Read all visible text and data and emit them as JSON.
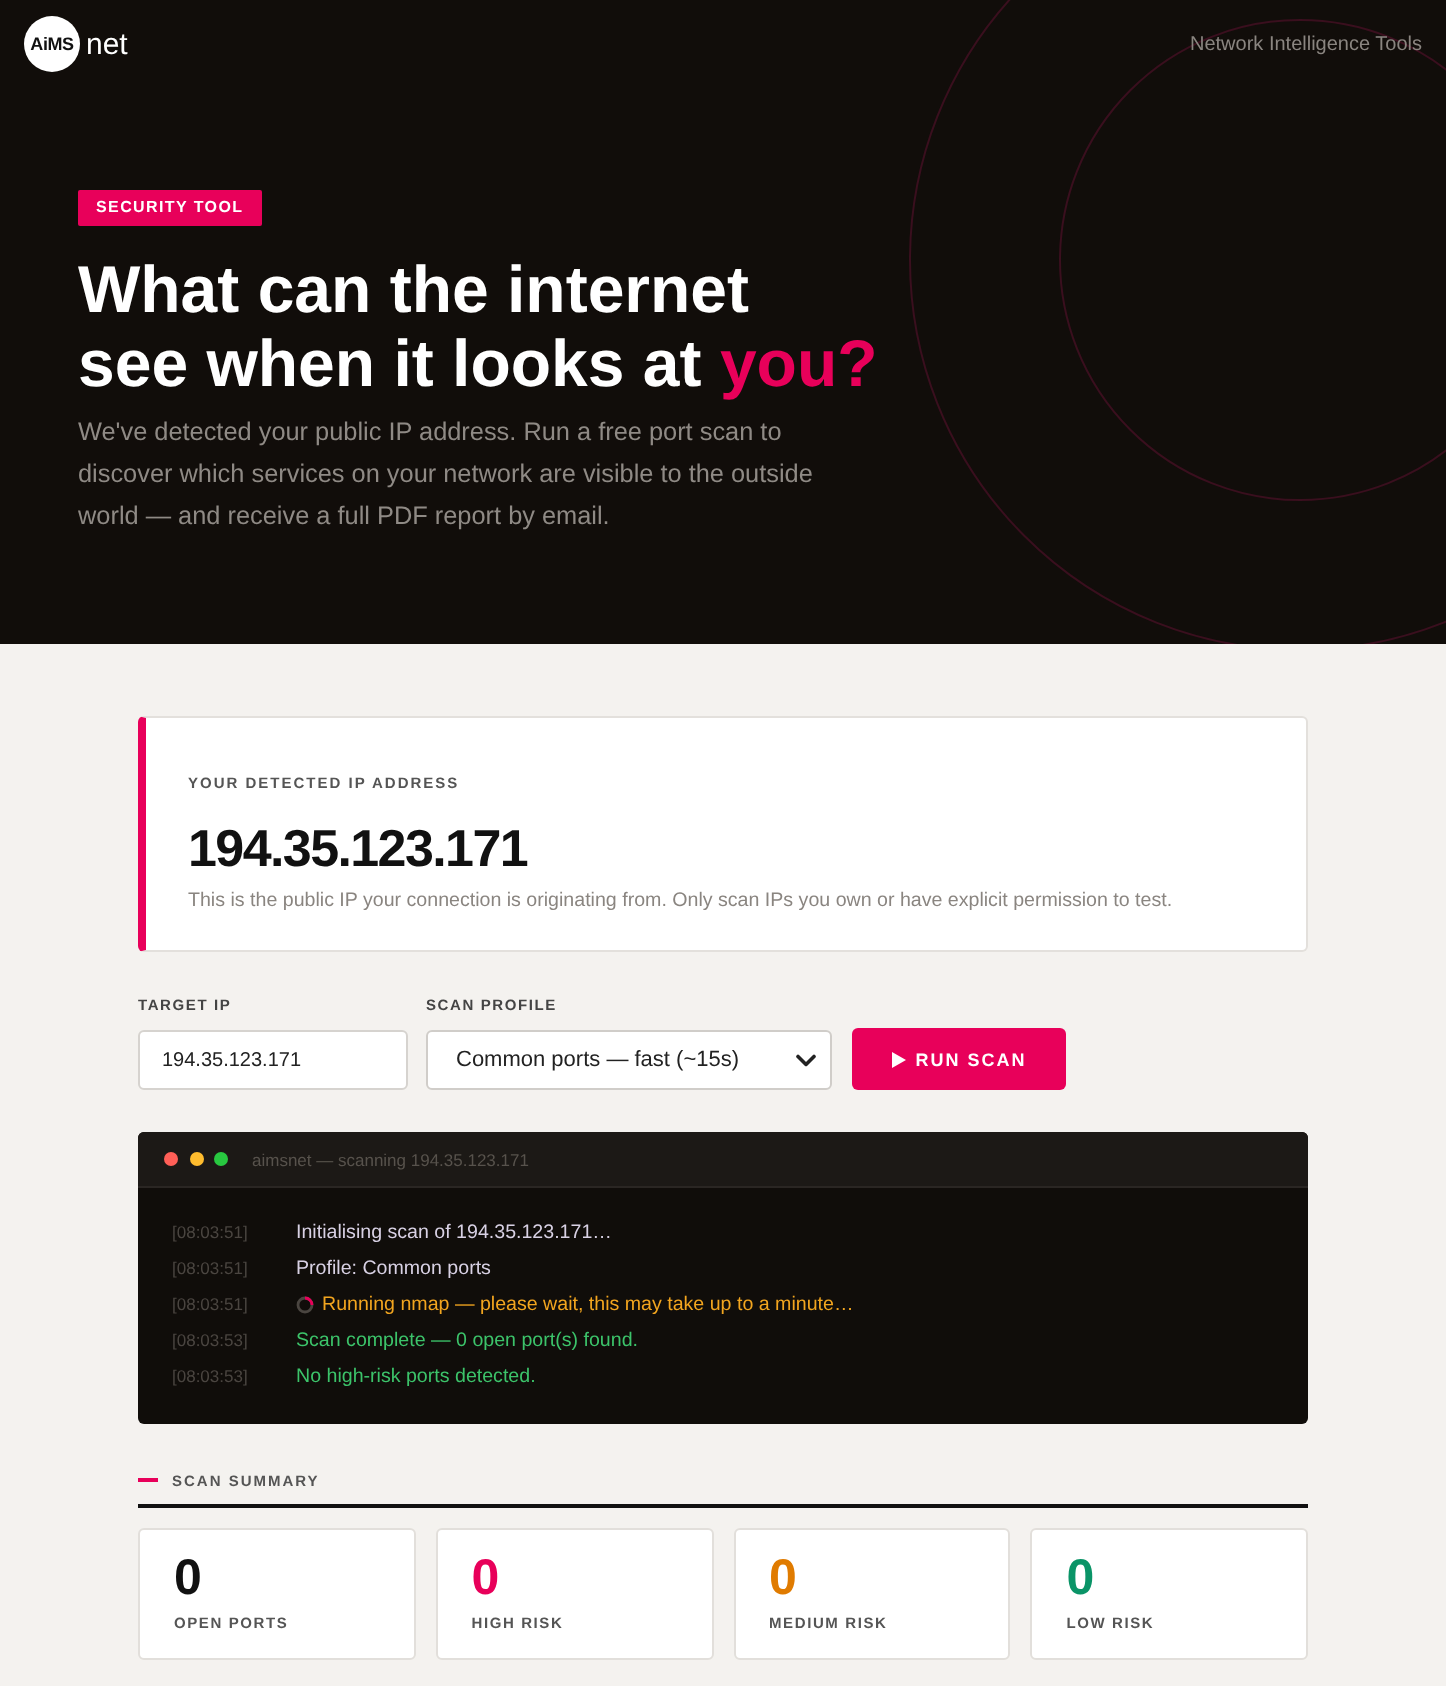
{
  "header": {
    "logo": {
      "mark": "AiMS",
      "name": "net"
    },
    "tagline": "Network Intelligence Tools"
  },
  "hero": {
    "badge": "SECURITY TOOL",
    "headline": [
      "What can the internet",
      "see when it looks at"
    ],
    "headline_highlight": "you?",
    "description": "We've detected your public IP address. Run a free port scan to discover which services on your network are visible to the outside world — and receive a full PDF report by email."
  },
  "ip_card": {
    "label": "YOUR DETECTED IP ADDRESS",
    "address": "194.35.123.171",
    "note": "This is the public IP your connection is originating from. Only scan IPs you own or have explicit permission to test."
  },
  "scan_form": {
    "target": {
      "label": "TARGET IP",
      "value": "194.35.123.171"
    },
    "profile": {
      "label": "SCAN PROFILE",
      "value": "Common ports — fast (~15s)"
    },
    "button": "RUN SCAN"
  },
  "terminal": {
    "title": "aimsnet — scanning 194.35.123.171",
    "lines": [
      {
        "time": "[08:03:51]",
        "text": "Initialising scan of 194.35.123.171…",
        "kind": "info"
      },
      {
        "time": "[08:03:51]",
        "text": "Profile: Common ports",
        "kind": "info"
      },
      {
        "time": "[08:03:51]",
        "text": "Running nmap — please wait, this may take up to a minute…",
        "kind": "running"
      },
      {
        "time": "[08:03:53]",
        "text": "Scan complete — 0 open port(s) found.",
        "kind": "success"
      },
      {
        "time": "[08:03:53]",
        "text": "No high-risk ports detected.",
        "kind": "success"
      }
    ]
  },
  "summary": {
    "title": "SCAN SUMMARY",
    "stats": [
      {
        "value": "0",
        "label": "OPEN PORTS",
        "color": "#111111"
      },
      {
        "value": "0",
        "label": "HIGH RISK",
        "color": "#e8005a"
      },
      {
        "value": "0",
        "label": "MEDIUM RISK",
        "color": "#e07b00"
      },
      {
        "value": "0",
        "label": "LOW RISK",
        "color": "#0a9467"
      }
    ]
  }
}
